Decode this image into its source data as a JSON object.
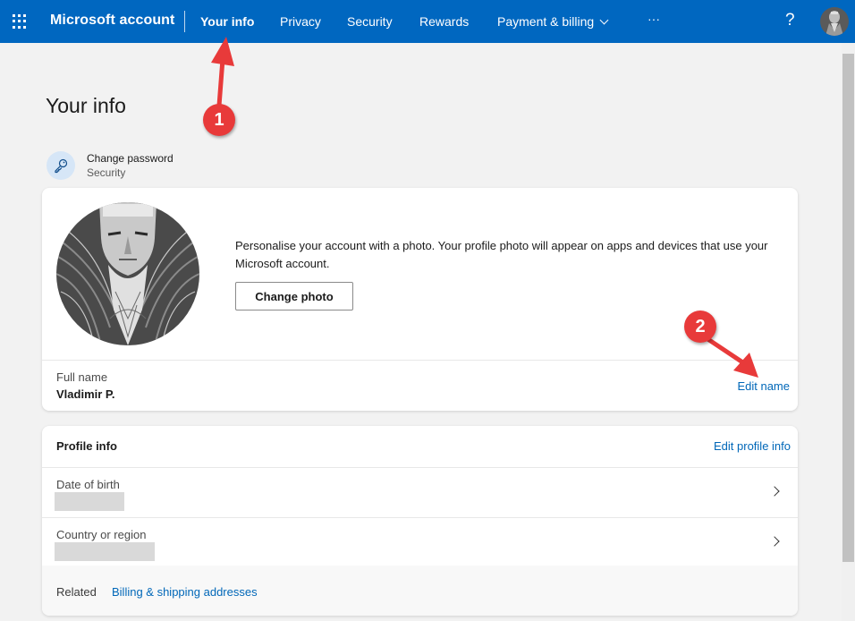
{
  "topbar": {
    "brand": "Microsoft account",
    "nav": [
      {
        "label": "Your info",
        "active": true
      },
      {
        "label": "Privacy"
      },
      {
        "label": "Security"
      },
      {
        "label": "Rewards"
      },
      {
        "label": "Payment & billing",
        "has_dropdown": true
      },
      {
        "label": "···"
      }
    ],
    "help_label": "?",
    "icons": [
      "waffle-icon",
      "help-icon",
      "avatar"
    ]
  },
  "page": {
    "title": "Your info",
    "change_password": {
      "title": "Change password",
      "subtitle": "Security",
      "icon": "key-icon"
    }
  },
  "photo_card": {
    "description": "Personalise your account with a photo. Your profile photo will appear on apps and devices that use your Microsoft account.",
    "change_photo_label": "Change photo",
    "full_name_label": "Full name",
    "full_name_value": "Vladimir P.",
    "edit_name_label": "Edit name"
  },
  "profile_card": {
    "title": "Profile info",
    "edit_label": "Edit profile info",
    "rows": [
      {
        "label": "Date of birth",
        "value": "[redacted]"
      },
      {
        "label": "Country or region",
        "value": "[redacted]"
      }
    ],
    "related_label": "Related",
    "related_link": "Billing & shipping addresses"
  },
  "annotations": [
    {
      "number": "1",
      "target": "Your info"
    },
    {
      "number": "2",
      "target": "Edit name"
    }
  ],
  "colors": {
    "header_bg": "#0067c0",
    "link": "#0067b8",
    "annotation": "#e83a3a",
    "page_bg": "#f2f2f2"
  }
}
